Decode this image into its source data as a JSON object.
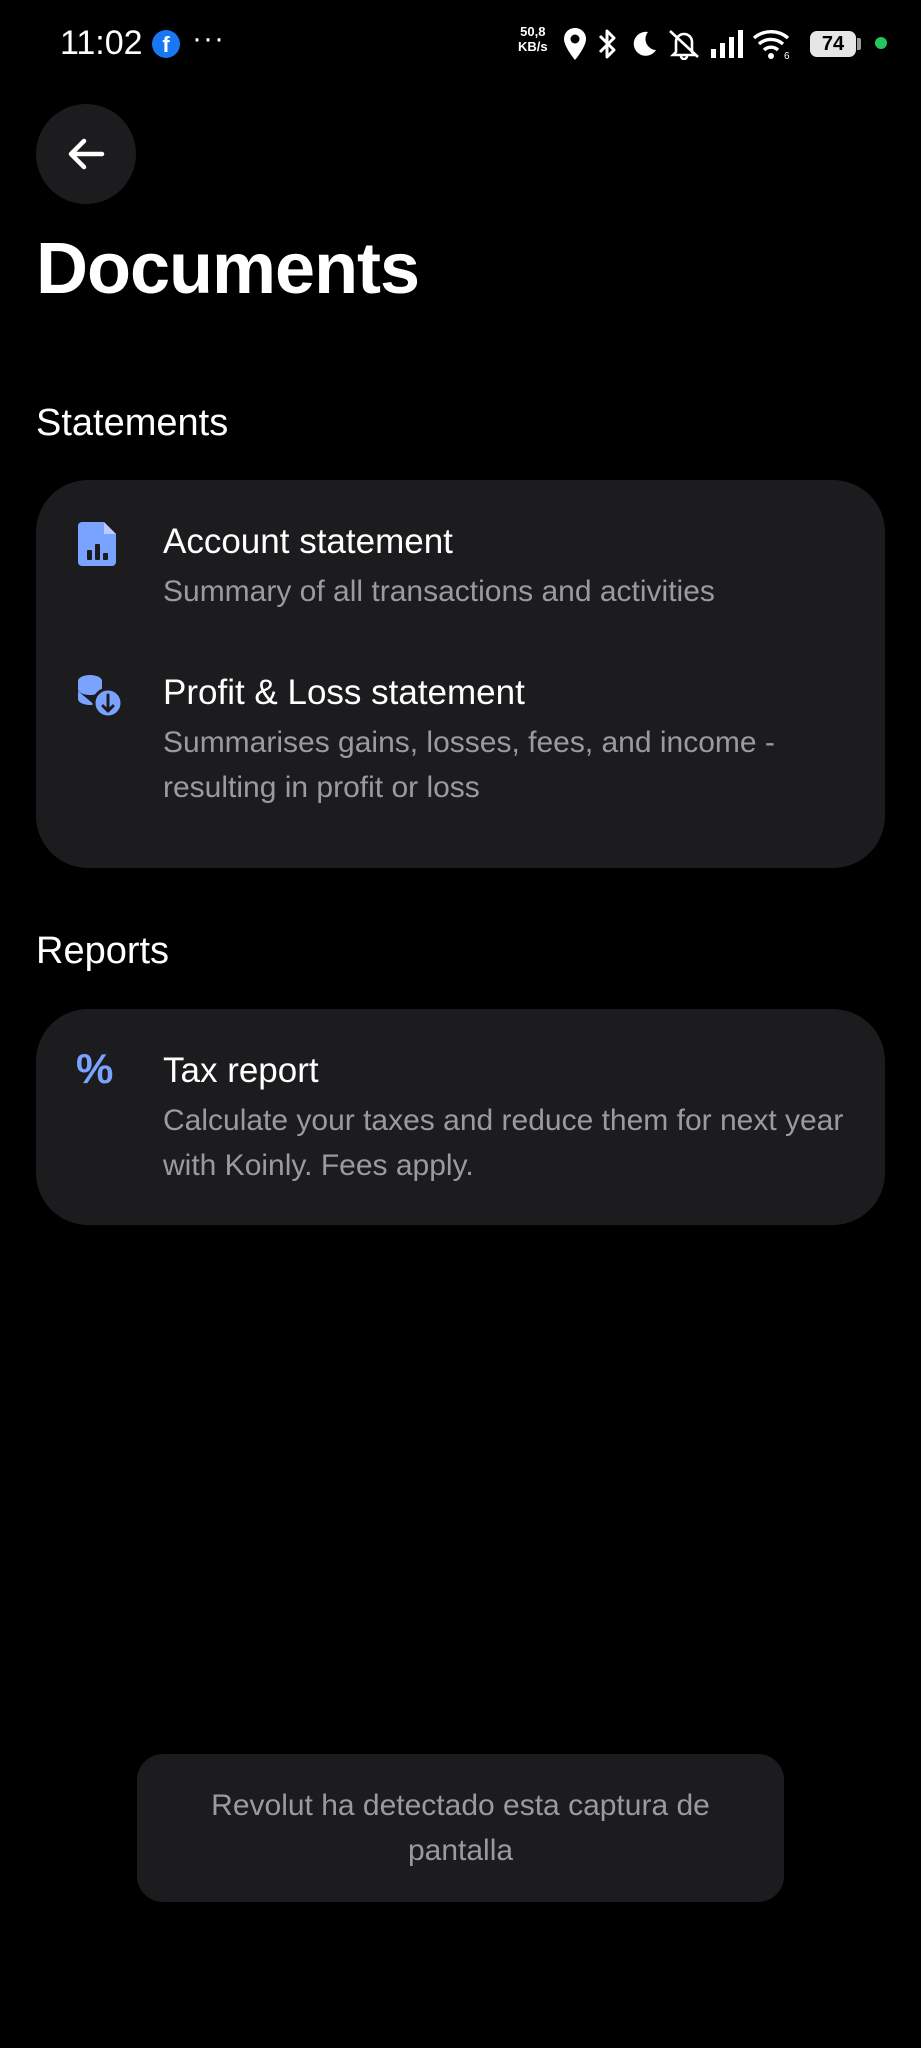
{
  "status_bar": {
    "time": "11:02",
    "notification_app": "f",
    "more": "···",
    "net_speed_value": "50,8",
    "net_speed_unit": "KB/s",
    "battery": "74",
    "icons": [
      "location-icon",
      "bluetooth-icon",
      "moon-icon",
      "muted-bell-icon",
      "signal-icon",
      "wifi-icon"
    ]
  },
  "header": {
    "title": "Documents"
  },
  "sections": {
    "statements": {
      "title": "Statements",
      "items": [
        {
          "title": "Account statement",
          "description": "Summary of all transactions and activities",
          "icon": "file-chart-icon"
        },
        {
          "title": "Profit & Loss statement",
          "description": "Summarises gains, losses, fees, and income - resulting in profit or loss",
          "icon": "coins-icon"
        }
      ]
    },
    "reports": {
      "title": "Reports",
      "items": [
        {
          "title": "Tax report",
          "description": "Calculate your taxes and reduce them for next year with Koinly. Fees apply.",
          "icon": "percent-icon"
        }
      ]
    }
  },
  "toast": {
    "text": "Revolut ha detectado esta captura de pantalla"
  },
  "colors": {
    "background": "#000000",
    "card": "#1c1c1e",
    "accent_icon": "#7aa2ff",
    "secondary_text": "#9a9aa0"
  }
}
